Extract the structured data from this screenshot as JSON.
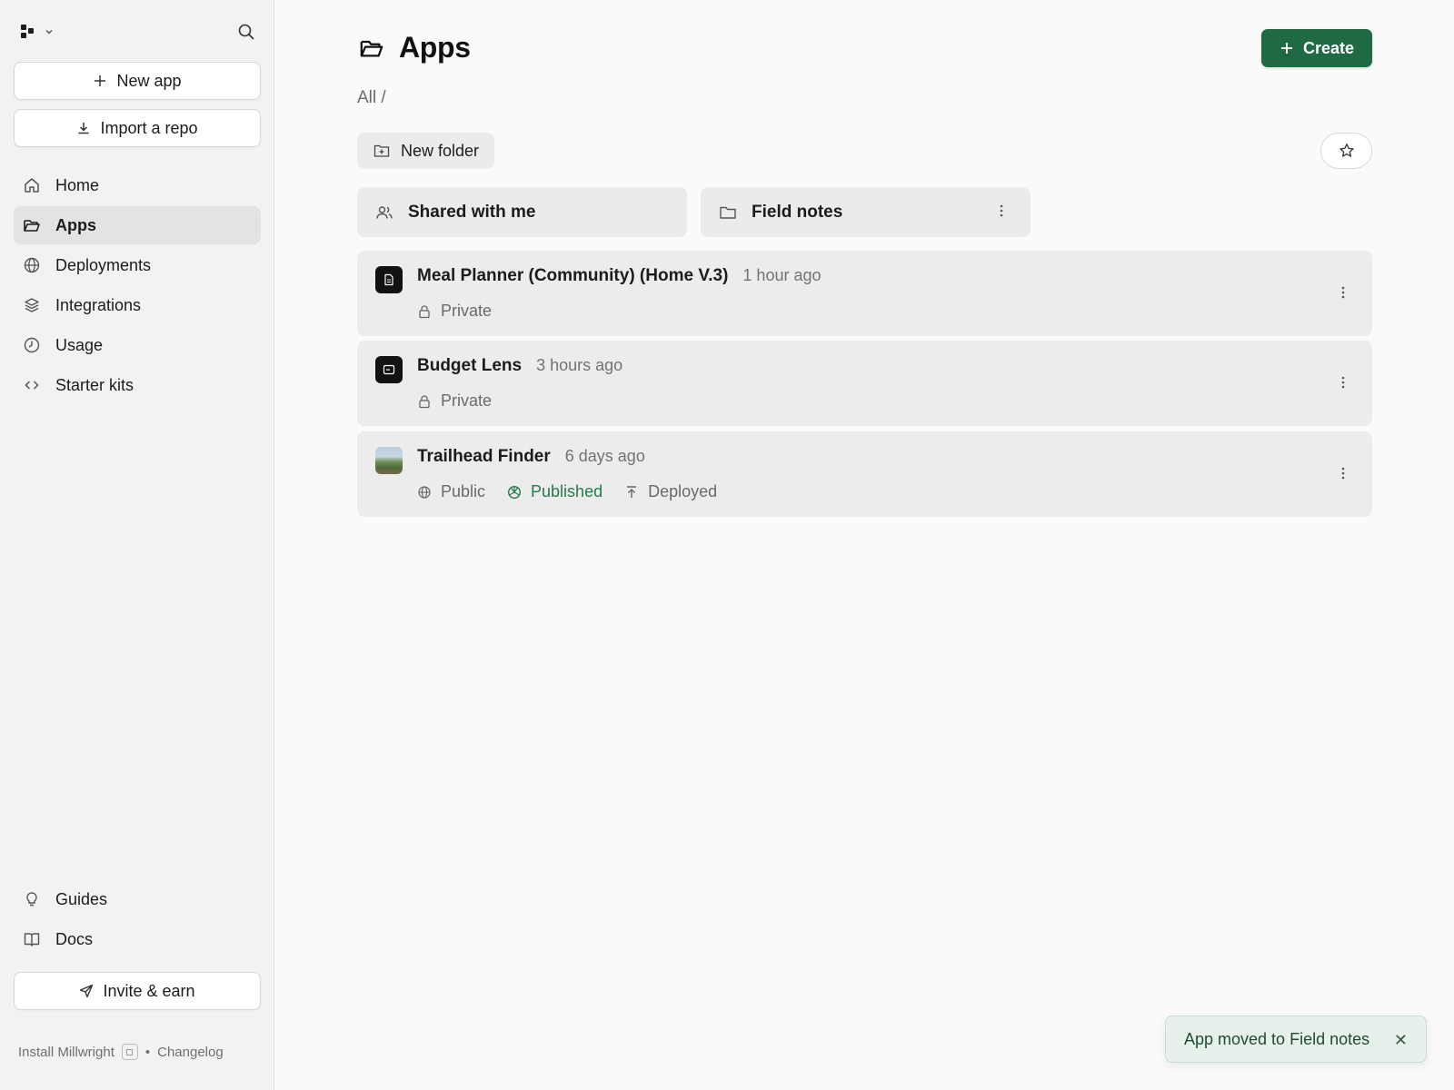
{
  "sidebar": {
    "new_app_label": "New app",
    "import_label": "Import a repo",
    "nav": [
      {
        "label": "Home",
        "icon": "home-icon"
      },
      {
        "label": "Apps",
        "icon": "folder-open-icon",
        "active": true
      },
      {
        "label": "Deployments",
        "icon": "globe-icon"
      },
      {
        "label": "Integrations",
        "icon": "layers-icon"
      },
      {
        "label": "Usage",
        "icon": "clock-icon"
      },
      {
        "label": "Starter kits",
        "icon": "code-icon"
      }
    ],
    "bottom_nav": [
      {
        "label": "Guides",
        "icon": "lightbulb-icon"
      },
      {
        "label": "Docs",
        "icon": "book-icon"
      }
    ],
    "invite_label": "Invite & earn",
    "install_label": "Install Millwright",
    "changelog_label": "Changelog",
    "separator": "•"
  },
  "header": {
    "title": "Apps",
    "create_label": "Create",
    "breadcrumb": "All /"
  },
  "toolbar": {
    "new_folder_label": "New folder"
  },
  "folders": [
    {
      "label": "Shared with me",
      "icon": "users-icon"
    },
    {
      "label": "Field notes",
      "icon": "folder-icon"
    }
  ],
  "apps": [
    {
      "name": "Meal Planner (Community) (Home V.3)",
      "time": "1 hour ago",
      "visibility": "Private"
    },
    {
      "name": "Budget Lens",
      "time": "3 hours ago",
      "visibility": "Private"
    },
    {
      "name": "Trailhead Finder",
      "time": "6 days ago",
      "visibility": "Public",
      "status": "Published",
      "deploy": "Deployed"
    }
  ],
  "toast": {
    "message": "App moved to Field notes",
    "close": "✕"
  },
  "colors": {
    "accent": "#1f6a45",
    "published": "#257a4c",
    "toast_bg": "#e7f1eb"
  }
}
